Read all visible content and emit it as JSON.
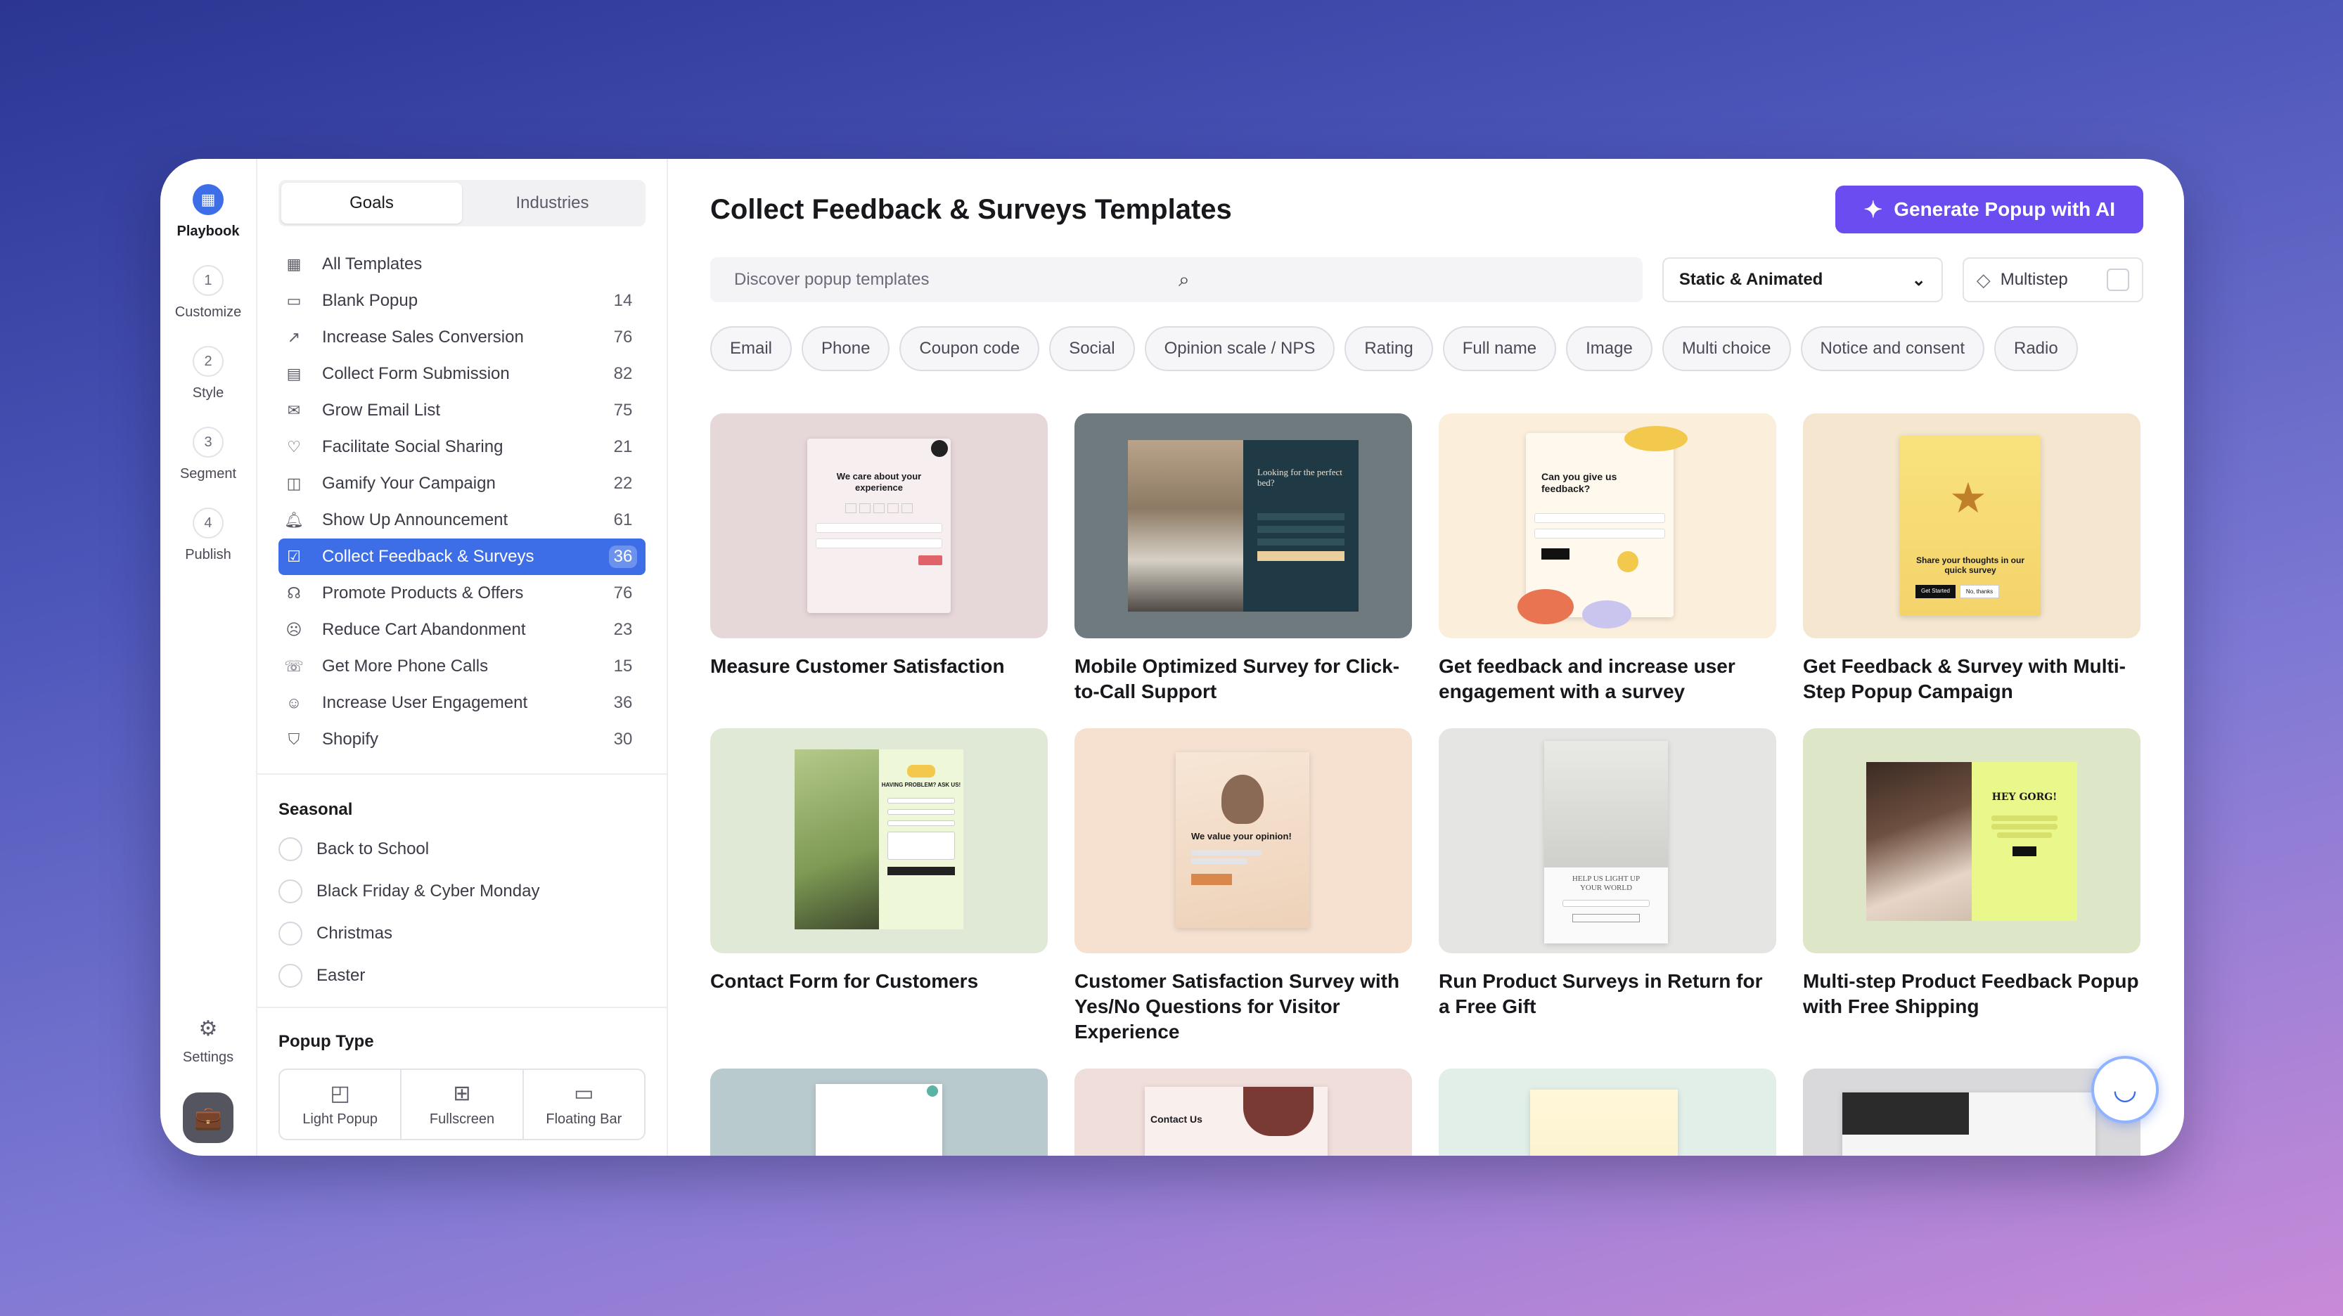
{
  "rail": {
    "items": [
      {
        "step": "",
        "label": "Playbook"
      },
      {
        "step": "1",
        "label": "Customize"
      },
      {
        "step": "2",
        "label": "Style"
      },
      {
        "step": "3",
        "label": "Segment"
      },
      {
        "step": "4",
        "label": "Publish"
      }
    ],
    "settings_label": "Settings"
  },
  "sidebar": {
    "tabs": [
      "Goals",
      "Industries"
    ],
    "goals": [
      {
        "label": "All Templates",
        "count": ""
      },
      {
        "label": "Blank Popup",
        "count": "14"
      },
      {
        "label": "Increase Sales Conversion",
        "count": "76"
      },
      {
        "label": "Collect Form Submission",
        "count": "82"
      },
      {
        "label": "Grow Email List",
        "count": "75"
      },
      {
        "label": "Facilitate Social Sharing",
        "count": "21"
      },
      {
        "label": "Gamify Your Campaign",
        "count": "22"
      },
      {
        "label": "Show Up Announcement",
        "count": "61"
      },
      {
        "label": "Collect Feedback & Surveys",
        "count": "36"
      },
      {
        "label": "Promote Products & Offers",
        "count": "76"
      },
      {
        "label": "Reduce Cart Abandonment",
        "count": "23"
      },
      {
        "label": "Get More Phone Calls",
        "count": "15"
      },
      {
        "label": "Increase User Engagement",
        "count": "36"
      },
      {
        "label": "Shopify",
        "count": "30"
      }
    ],
    "seasonal_title": "Seasonal",
    "seasonal": [
      "Back to School",
      "Black Friday & Cyber Monday",
      "Christmas",
      "Easter"
    ],
    "popup_type_title": "Popup Type",
    "popup_types": [
      "Light Popup",
      "Fullscreen",
      "Floating Bar"
    ]
  },
  "main": {
    "title": "Collect Feedback & Surveys Templates",
    "ai_button": "Generate Popup with AI",
    "search_placeholder": "Discover popup templates",
    "select_value": "Static & Animated",
    "multistep_label": "Multistep",
    "chips": [
      "Email",
      "Phone",
      "Coupon code",
      "Social",
      "Opinion scale / NPS",
      "Rating",
      "Full name",
      "Image",
      "Multi choice",
      "Notice and consent",
      "Radio"
    ],
    "cards": [
      {
        "title": "Measure Customer Satisfaction"
      },
      {
        "title": "Mobile Optimized Survey for Click-to-Call Support"
      },
      {
        "title": "Get feedback and increase user engagement with a survey"
      },
      {
        "title": "Get Feedback & Survey with Multi-Step Popup Campaign"
      },
      {
        "title": "Contact Form for Customers"
      },
      {
        "title": "Customer Satisfaction Survey with Yes/No Questions for Visitor Experience"
      },
      {
        "title": "Run Product Surveys in Return for a Free Gift"
      },
      {
        "title": "Multi-step Product Feedback Popup with Free Shipping"
      }
    ],
    "thumb_text": {
      "t1": "We care about your experience",
      "t2": "Looking for the perfect bed?",
      "t3": "Can you give us feedback?",
      "t4": "Share your thoughts in our quick survey",
      "t4_btn1": "Get Started",
      "t4_btn2": "No, thanks",
      "t5": "HAVING PROBLEM? ASK US!",
      "t6": "We value your opinion!",
      "t7": "HELP US LIGHT UP YOUR WORLD",
      "t8": "HEY GORG!",
      "t10": "Contact Us"
    }
  },
  "colors": {
    "accent": "#3d6ee8",
    "ai_button": "#6b4cf0"
  }
}
